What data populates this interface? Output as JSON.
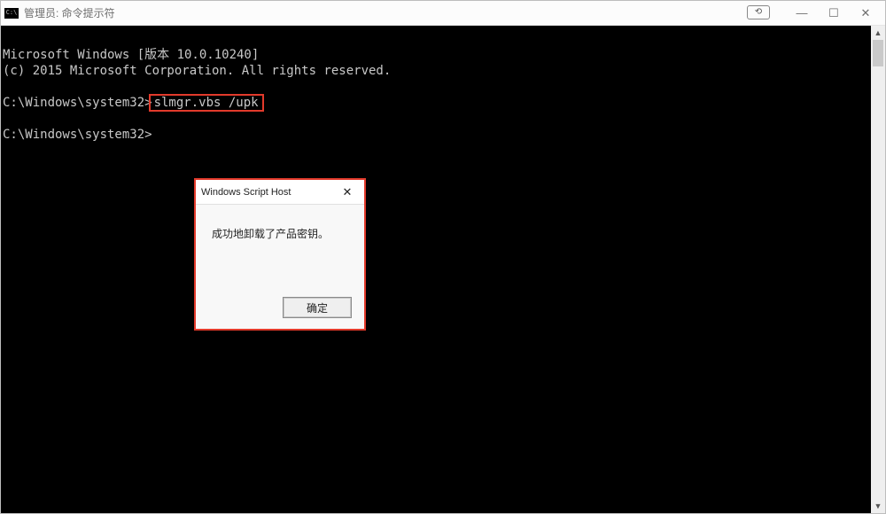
{
  "window": {
    "title": "管理员: 命令提示符",
    "sync_icon_glyph": "⟲"
  },
  "terminal": {
    "line1": "Microsoft Windows [版本 10.0.10240]",
    "line2": "(c) 2015 Microsoft Corporation. All rights reserved.",
    "prompt1_prefix": "C:\\Windows\\system32>",
    "prompt1_cmd": "slmgr.vbs /upk",
    "prompt2": "C:\\Windows\\system32>"
  },
  "dialog": {
    "title": "Windows Script Host",
    "message": "成功地卸载了产品密钥。",
    "ok_label": "确定"
  },
  "colors": {
    "highlight": "#e23a2b",
    "term_fg": "#c8c8c8",
    "term_bg": "#000000"
  }
}
